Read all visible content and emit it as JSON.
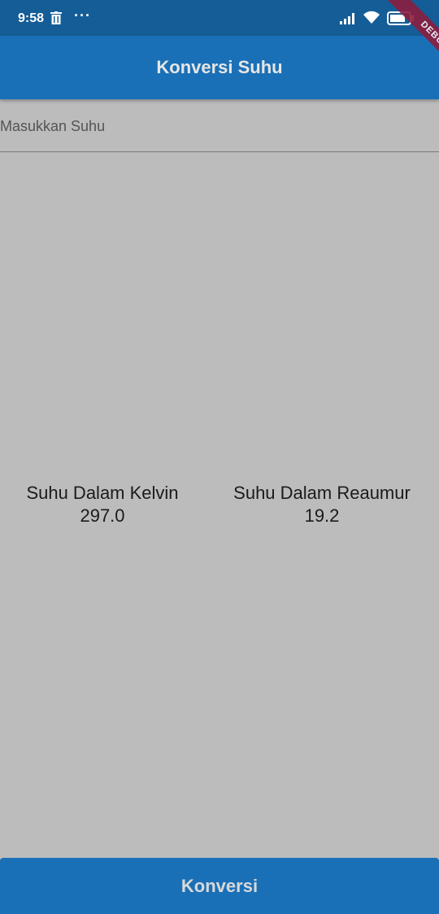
{
  "status_bar": {
    "time": "9:58",
    "more_label": "···",
    "icons": [
      "trash-icon",
      "more-icon",
      "signal-icon",
      "wifi-icon",
      "battery-icon"
    ]
  },
  "debug_banner": "DEBUG",
  "app_bar": {
    "title": "Konversi Suhu"
  },
  "input": {
    "placeholder": "Masukkan Suhu",
    "value": ""
  },
  "results": {
    "kelvin_label": "Suhu Dalam Kelvin",
    "kelvin_value": "297.0",
    "reaumur_label": "Suhu Dalam Reaumur",
    "reaumur_value": "19.2"
  },
  "button": {
    "label": "Konversi"
  },
  "colors": {
    "status_bar": "#155d97",
    "primary": "#1a70b7",
    "background": "#bcbcbc",
    "debug_ribbon": "#8b1e3f"
  }
}
